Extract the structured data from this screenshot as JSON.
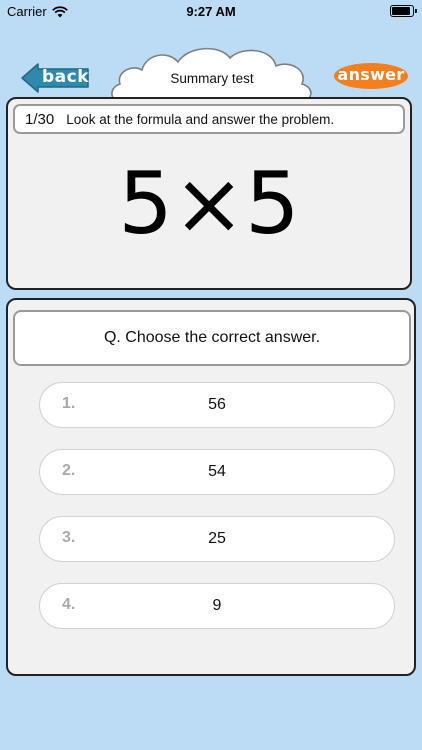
{
  "status_bar": {
    "carrier": "Carrier",
    "time": "9:27 AM",
    "wifi_icon": "wifi-icon",
    "battery_icon": "battery-icon"
  },
  "header": {
    "back_label": "back",
    "title": "Summary test",
    "answer_label": "answer"
  },
  "question": {
    "counter": "1/30",
    "instruction": "Look at the formula and answer the problem.",
    "formula": "5×5"
  },
  "answers": {
    "prompt": "Q. Choose the correct answer.",
    "options": [
      {
        "number": "1.",
        "value": "56"
      },
      {
        "number": "2.",
        "value": "54"
      },
      {
        "number": "3.",
        "value": "25"
      },
      {
        "number": "4.",
        "value": "9"
      }
    ]
  },
  "colors": {
    "background": "#bcdcf6",
    "back_button": "#2e8aa8",
    "answer_button": "#f57f1c",
    "card": "#f1f1f1"
  }
}
